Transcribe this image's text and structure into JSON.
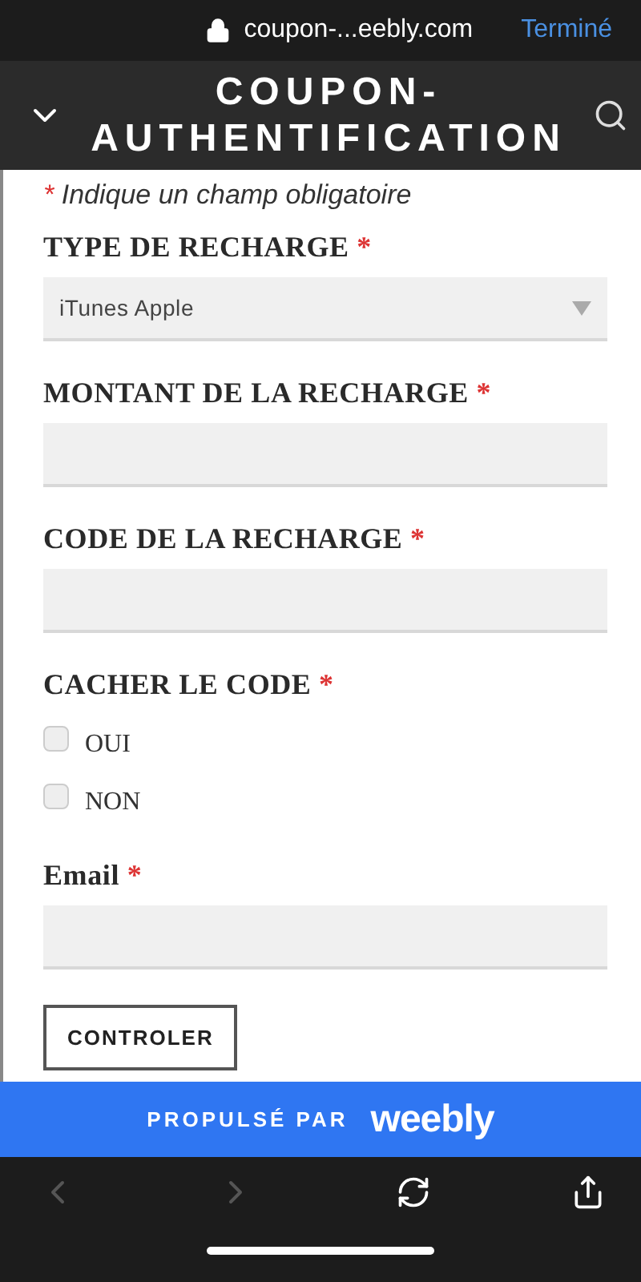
{
  "browser_bar": {
    "url": "coupon-...eebly.com",
    "done_button": "Terminé"
  },
  "header": {
    "title_lines": [
      "COUPON-",
      "AUTHENTIFICATION"
    ]
  },
  "form": {
    "required_note": {
      "mark": "*",
      "text": "Indique un champ obligatoire"
    },
    "fields": [
      {
        "kind": "select",
        "label": "TYPE DE RECHARGE",
        "required_mark": "*",
        "value": "iTunes Apple"
      },
      {
        "kind": "text",
        "label": "MONTANT DE LA RECHARGE",
        "required_mark": "*"
      },
      {
        "kind": "text",
        "label": "CODE DE LA RECHARGE",
        "required_mark": "*"
      },
      {
        "kind": "checkboxes",
        "label": "CACHER LE CODE",
        "required_mark": "*",
        "options": [
          {
            "label": "OUI",
            "checked": false
          },
          {
            "label": "NON",
            "checked": false
          }
        ]
      },
      {
        "kind": "text",
        "label": "Email",
        "required_mark": "*"
      }
    ],
    "submit_button": "CONTROLER"
  },
  "footer": {
    "text": "PROPULSÉ PAR",
    "brand": "weebly"
  },
  "toolbar": {
    "back": {
      "disabled": true
    },
    "forward": {
      "disabled": true
    }
  }
}
